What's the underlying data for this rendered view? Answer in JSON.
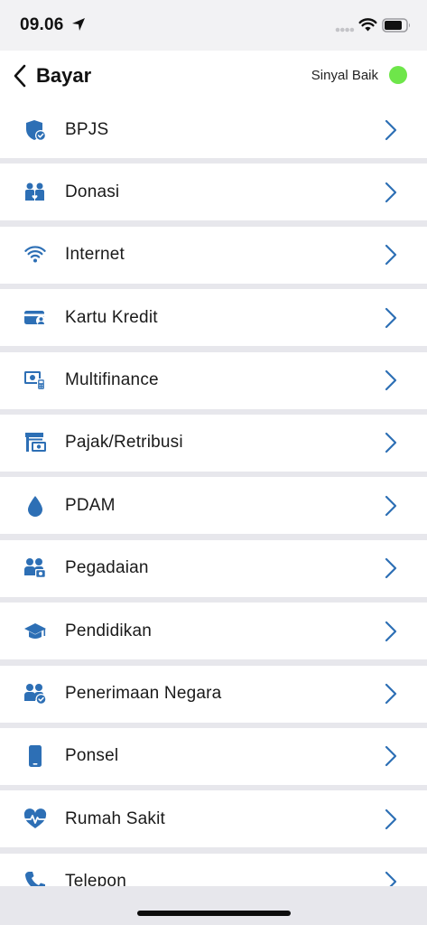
{
  "status_bar": {
    "time": "09.06",
    "icons": [
      "location-arrow-icon",
      "cellular-dots-icon",
      "wifi-icon",
      "battery-icon"
    ]
  },
  "header": {
    "back_icon": "chevron-left-icon",
    "title": "Bayar",
    "signal_text": "Sinyal Baik",
    "signal_color": "#6ee64a"
  },
  "colors": {
    "accent": "#2d6fb5",
    "background": "#e7e7ec",
    "row": "#ffffff"
  },
  "menu": {
    "items": [
      {
        "label": "BPJS",
        "icon": "shield-check-icon"
      },
      {
        "label": "Donasi",
        "icon": "donation-people-icon"
      },
      {
        "label": "Internet",
        "icon": "wifi-icon"
      },
      {
        "label": "Kartu Kredit",
        "icon": "credit-card-user-icon"
      },
      {
        "label": "Multifinance",
        "icon": "money-phone-icon"
      },
      {
        "label": "Pajak/Retribusi",
        "icon": "tax-building-icon"
      },
      {
        "label": "PDAM",
        "icon": "water-drop-icon"
      },
      {
        "label": "Pegadaian",
        "icon": "people-money-icon"
      },
      {
        "label": "Pendidikan",
        "icon": "graduation-cap-icon"
      },
      {
        "label": "Penerimaan Negara",
        "icon": "people-check-icon"
      },
      {
        "label": "Ponsel",
        "icon": "mobile-phone-icon"
      },
      {
        "label": "Rumah Sakit",
        "icon": "heart-pulse-icon"
      },
      {
        "label": "Telepon",
        "icon": "telephone-icon"
      }
    ]
  }
}
